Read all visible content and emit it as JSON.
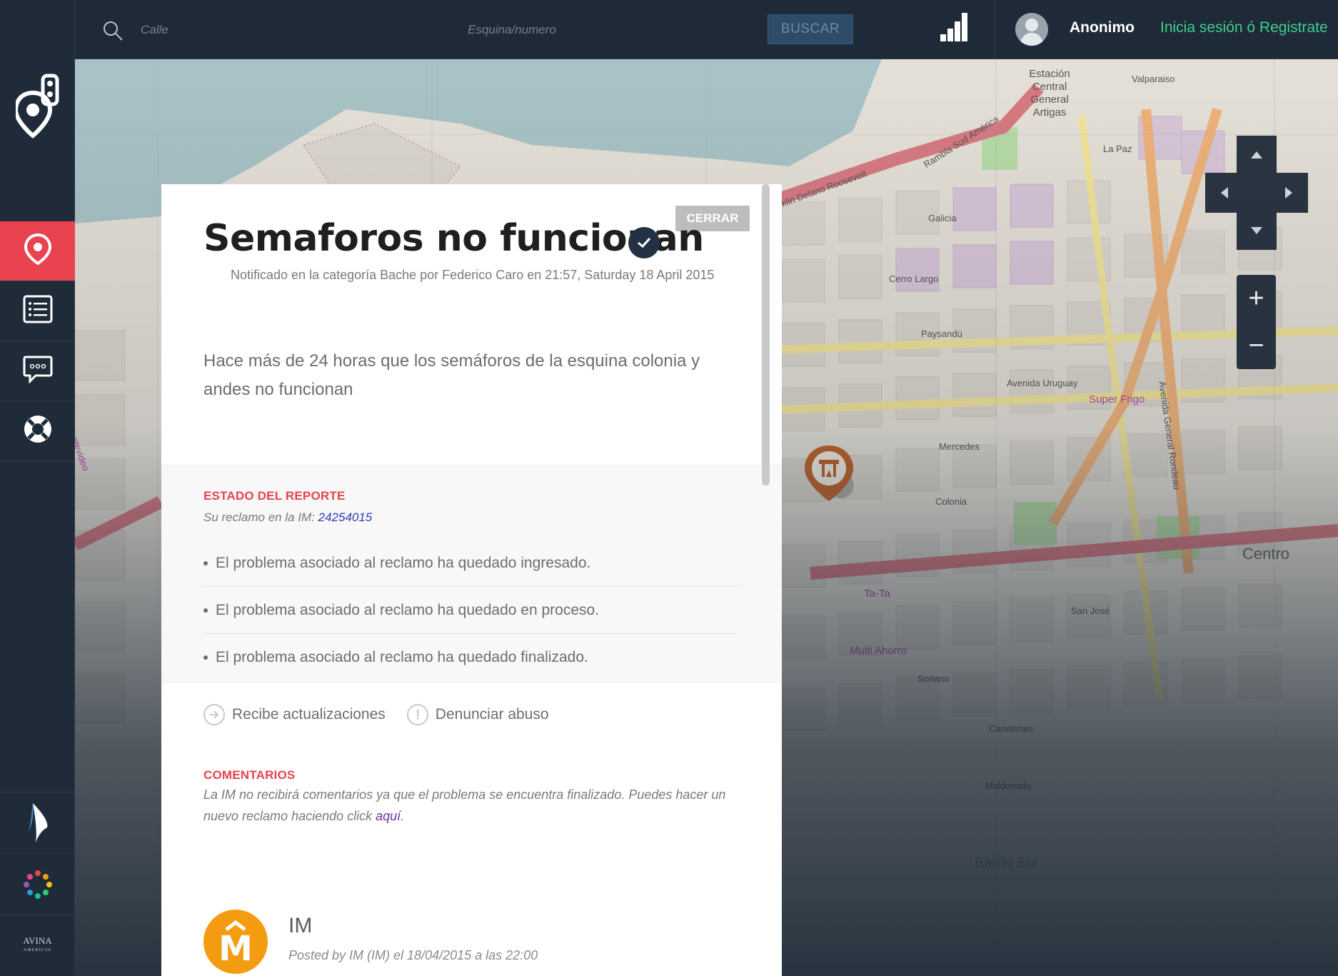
{
  "topbar": {
    "calle_placeholder": "Calle",
    "esquina_placeholder": "Esquina/numero",
    "search_button": "BUSCAR",
    "user_name": "Anonimo",
    "login_link": "Inicia sesión ó Registrate"
  },
  "sidebar": {
    "items": [
      {
        "icon": "map-pin-icon",
        "active": true
      },
      {
        "icon": "list-icon",
        "active": false
      },
      {
        "icon": "chat-icon",
        "active": false
      },
      {
        "icon": "lifebuoy-icon",
        "active": false
      }
    ],
    "footer_logo_text": "AVINA",
    "footer_logo_subtext": "AMERICAS"
  },
  "map": {
    "labels": {
      "rambla": "Rambla Sud América",
      "fdr": "Franklin Delano Roosevelt",
      "estacion": "Estación Central General Artigas",
      "valparaiso": "Valparaiso",
      "galicia": "Galicia",
      "cerro_largo": "Cerro Largo",
      "paysandu": "Paysandú",
      "av_uruguay": "Avenida Uruguay",
      "mercedes": "Mercedes",
      "colonia": "Colonia",
      "super_frigo": "Super Frigo",
      "ta_ta": "Ta-Ta",
      "san_jose": "San José",
      "multi_ahorro": "Multi Ahorro",
      "soriano": "Soriano",
      "canelones": "Canelones",
      "maldonado": "Maldonado",
      "centro": "Centro",
      "barrio_sur": "Barrio Sur",
      "la_paz": "La Paz",
      "av_rondeau": "Avenida General Rondeau",
      "montevideo": "Montevideo"
    },
    "zoom_in": "+",
    "zoom_out": "−"
  },
  "report": {
    "close_button": "CERRAR",
    "title": "Semaforos no funcionan",
    "meta": "Notificado en la categoría Bache por Federico Caro en 21:57, Saturday 18 April 2015",
    "description": "Hace más de 24 horas que los semáforos de la esquina colonia y andes no funcionan",
    "status_section": {
      "title": "ESTADO DEL REPORTE",
      "claim_prefix": "Su reclamo en la IM: ",
      "claim_number": "24254015",
      "items": [
        "El problema asociado al reclamo ha quedado ingresado.",
        "El problema asociado al reclamo ha quedado en proceso.",
        "El problema asociado al reclamo ha quedado finalizado."
      ]
    },
    "actions": {
      "subscribe": "Recibe actualizaciones",
      "report_abuse": "Denunciar abuso"
    },
    "comments": {
      "title": "COMENTARIOS",
      "note_text": "La IM no recibirá comentarios ya que el problema se encuentra finalizado. Puedes hacer un nuevo reclamo haciendo click ",
      "note_link": "aquí",
      "note_end": ".",
      "first": {
        "avatar_letter": "M",
        "author": "IM",
        "posted": "Posted by IM (IM) el 18/04/2015 a las 22:00"
      }
    }
  },
  "colors": {
    "accent_red": "#e8434e",
    "login_green": "#3fcf8e",
    "sidebar_bg": "#1f2b38",
    "pin_orange": "#c0632a",
    "im_orange": "#f39c12"
  }
}
